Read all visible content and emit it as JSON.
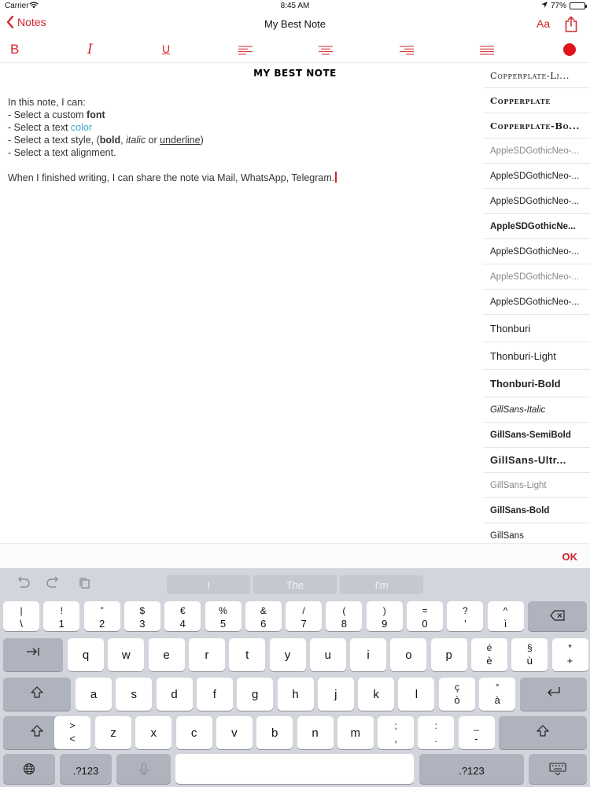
{
  "status": {
    "carrier": "Carrier",
    "time": "8:45 AM",
    "battery": "77%",
    "battery_level": 0.77
  },
  "nav": {
    "back_label": "Notes",
    "title": "My Best Note",
    "font_label": "Aa"
  },
  "toolbar": {
    "bold_label": "B",
    "italic_label": "I",
    "underline_label": "U",
    "text_color": "#e0141a"
  },
  "note": {
    "title": "MY BEST NOTE",
    "line1": "In this note, I can:",
    "line2_pre": "- Select a custom ",
    "line2_bold": "font",
    "line3_pre": "- Select a text ",
    "line3_color": "color",
    "line4_pre": "- Select a text style, (",
    "line4_bold": "bold",
    "line4_sep": ", ",
    "line4_italic": "italic",
    "line4_or": " or ",
    "line4_under": "underline",
    "line4_end": ")",
    "line5": "- Select a text alignment.",
    "line6": "When I finished writing, I can share the note via Mail, WhatsApp, Telegram."
  },
  "fonts": [
    "Copperplate-Li...",
    "Copperplate",
    "Copperplate-Bo...",
    "AppleSDGothicNeo-...",
    "AppleSDGothicNeo-...",
    "AppleSDGothicNeo-...",
    "AppleSDGothicNe...",
    "AppleSDGothicNeo-...",
    "AppleSDGothicNeo-...",
    "AppleSDGothicNeo-...",
    "Thonburi",
    "Thonburi-Light",
    "Thonburi-Bold",
    "GillSans-Italic",
    "GillSans-SemiBold",
    "GillSans-Ultr...",
    "GillSans-Light",
    "GillSans-Bold",
    "GillSans"
  ],
  "ok_label": "OK",
  "keyboard": {
    "suggestions": [
      "I",
      "The",
      "I'm"
    ],
    "row1": [
      [
        "|",
        "\\"
      ],
      [
        "!",
        "1"
      ],
      [
        "”",
        "2"
      ],
      [
        "$",
        "3"
      ],
      [
        "€",
        "4"
      ],
      [
        "%",
        "5"
      ],
      [
        "&",
        "6"
      ],
      [
        "/",
        "7"
      ],
      [
        "(",
        "8"
      ],
      [
        ")",
        "9"
      ],
      [
        "=",
        "0"
      ],
      [
        "?",
        "’"
      ],
      [
        "^",
        "ì"
      ]
    ],
    "row2": [
      "q",
      "w",
      "e",
      "r",
      "t",
      "y",
      "u",
      "i",
      "o",
      "p"
    ],
    "row2_extra": [
      [
        "é",
        "è"
      ],
      [
        "§",
        "ù"
      ],
      [
        "*",
        "+"
      ]
    ],
    "row3": [
      "a",
      "s",
      "d",
      "f",
      "g",
      "h",
      "j",
      "k",
      "l"
    ],
    "row3_extra": [
      [
        "ç",
        "ò"
      ],
      [
        "°",
        "à"
      ]
    ],
    "row4": [
      "z",
      "x",
      "c",
      "v",
      "b",
      "n",
      "m"
    ],
    "row4_extra": [
      [
        ">",
        "<"
      ],
      [
        ";",
        ","
      ],
      [
        ":",
        "."
      ],
      [
        "_",
        "-"
      ]
    ],
    "mode_label": ".?123"
  }
}
